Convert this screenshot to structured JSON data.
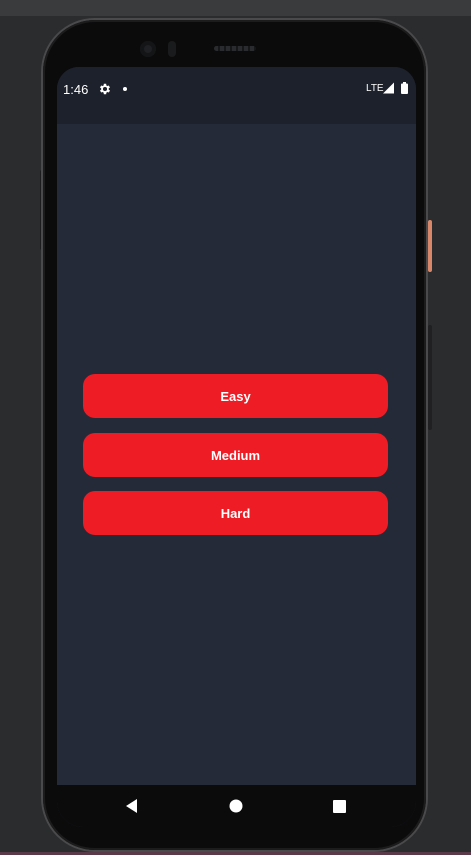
{
  "status_bar": {
    "time": "1:46",
    "network": "LTE",
    "icons": [
      "gear-icon",
      "dot-icon",
      "signal-icon",
      "battery-icon"
    ]
  },
  "menu": {
    "buttons": [
      {
        "label": "Easy"
      },
      {
        "label": "Medium"
      },
      {
        "label": "Hard"
      }
    ]
  },
  "nav_bar": {
    "icons": [
      "back-icon",
      "home-icon",
      "recents-icon"
    ]
  },
  "colors": {
    "button": "#ee1c25",
    "screen_background": "#242a37",
    "status_bar": "#1c212b",
    "power_key_accent": "#d9876a"
  }
}
